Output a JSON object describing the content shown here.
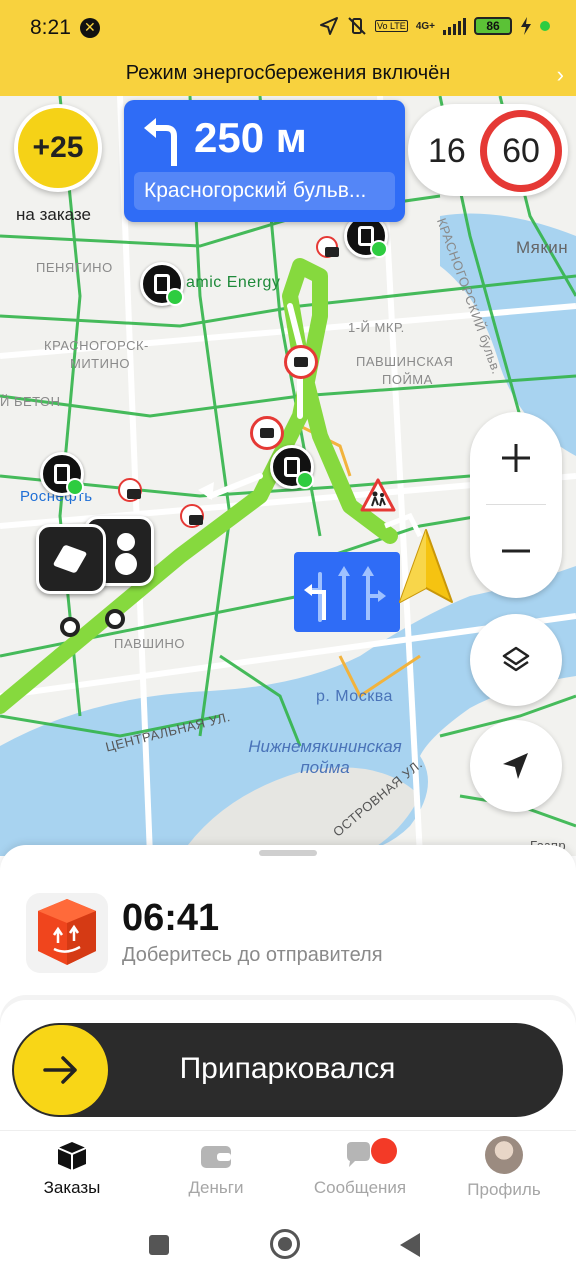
{
  "status_bar": {
    "time": "8:21",
    "network": "4G+",
    "lte": "Vo LTE",
    "battery": "86",
    "icons": [
      "location-arrow-icon",
      "vibrate-off-icon",
      "signal-icon",
      "charging-icon"
    ]
  },
  "power_banner": {
    "text": "Режим энергосбережения включён",
    "chevron": "›"
  },
  "bonus": {
    "value": "+25",
    "caption": "на заказе"
  },
  "maneuver": {
    "distance": "250 м",
    "street": "Красногорский бульв...",
    "icon": "turn-left-arrow-icon"
  },
  "speed": {
    "current": "16",
    "limit": "60"
  },
  "map": {
    "labels": {
      "penyagino": "ПЕНЯГИНО",
      "dynamic_energy": "amic Energy",
      "myakinino": "Мякин",
      "krasnogorsk_mitino_1": "КРАСНОГОРСК-",
      "krasnogorsk_mitino_2": "МИТИНО",
      "first_mkr": "1-Й МКР.",
      "pavshinskaya_1": "ПАВШИНСКАЯ",
      "pavshinskaya_2": "ПОЙМА",
      "beton": "Й БЕТОН",
      "rosneft": "Роснефть",
      "pavshino": "ПАВШИНО",
      "krasnogorsky_blvd": "КРАСНОГОРСКИЙ бульв.",
      "tsentralnaya": "ЦЕНТРАЛЬНАЯ УЛ.",
      "river": "р. Москва",
      "floodplain_1": "Нижнемякининская",
      "floodplain_2": "пойма",
      "ostrovnaya": "ОСТРОВНАЯ УЛ.",
      "gazprom": "Газпр"
    },
    "colors": {
      "route": "#86d93e",
      "water": "#a8d3f0",
      "traffic_green": "#33b54a",
      "accent_blue": "#2f6cf6"
    }
  },
  "order": {
    "time": "06:41",
    "subtitle": "Доберитесь до отправителя",
    "icon": "parcel-box-icon"
  },
  "slider": {
    "label": "Припарковался",
    "icon": "arrow-right-icon"
  },
  "tabs": [
    {
      "label": "Заказы",
      "icon": "orders-box-icon",
      "active": true
    },
    {
      "label": "Деньги",
      "icon": "wallet-icon",
      "active": false
    },
    {
      "label": "Сообщения",
      "icon": "chat-bubbles-icon",
      "active": false
    },
    {
      "label": "Профиль",
      "icon": "avatar-icon",
      "active": false
    }
  ]
}
